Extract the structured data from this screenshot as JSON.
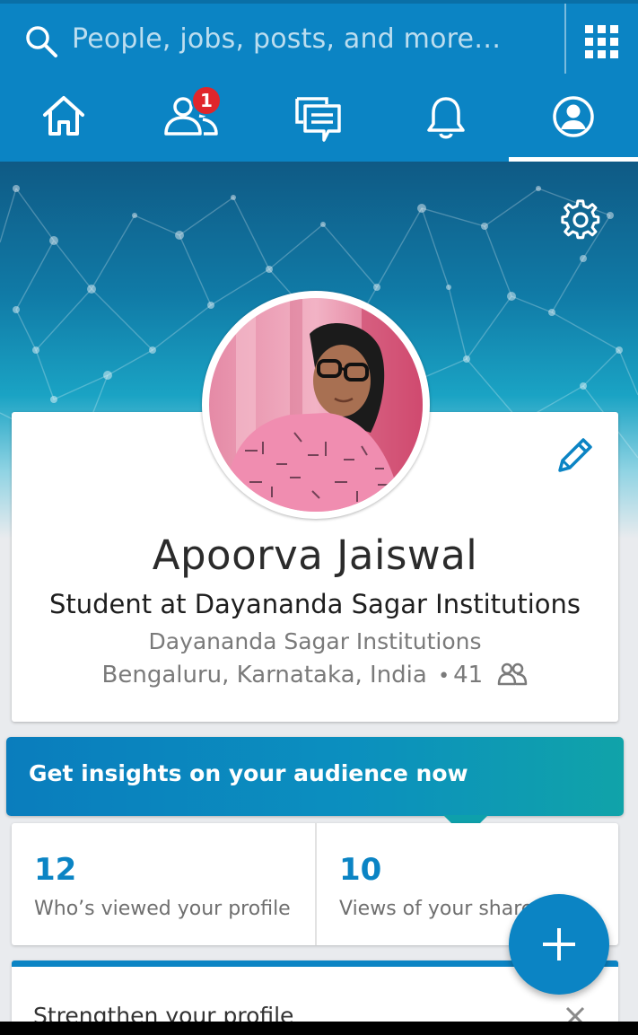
{
  "search": {
    "placeholder": "People, jobs, posts, and more…"
  },
  "nav": {
    "tabs": [
      {
        "name": "home",
        "icon": "home-icon"
      },
      {
        "name": "my-network",
        "icon": "people-icon",
        "badge": "1"
      },
      {
        "name": "messaging",
        "icon": "messages-icon"
      },
      {
        "name": "notifications",
        "icon": "bell-icon"
      },
      {
        "name": "me",
        "icon": "profile-icon",
        "active": true
      }
    ],
    "badge_count": "1"
  },
  "profile": {
    "name": "Apoorva Jaiswal",
    "headline": "Student at Dayananda Sagar Institutions",
    "company": "Dayananda Sagar Institutions",
    "location": "Bengaluru, Karnataka, India",
    "separator": "•",
    "connections": "41"
  },
  "insights": {
    "text": "Get insights on your audience now"
  },
  "stats": [
    {
      "value": "12",
      "label": "Who’s viewed your profile"
    },
    {
      "value": "10",
      "label": "Views of your share"
    }
  ],
  "strengthen": {
    "title": "Strengthen your profile"
  },
  "colors": {
    "brand_blue": "#0b84c4",
    "badge_red": "#e0262b",
    "insights_teal": "#10a3a9"
  }
}
